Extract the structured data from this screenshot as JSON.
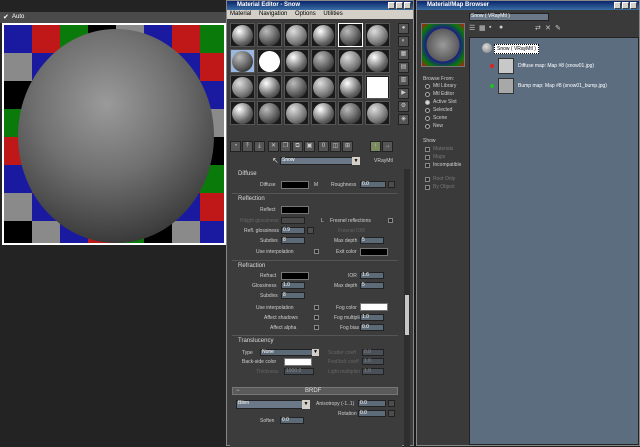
{
  "viewport": {
    "auto_label": "Auto"
  },
  "material_editor": {
    "title": "Material Editor - Snow",
    "menus": [
      "Material",
      "Navigation",
      "Options",
      "Utilities"
    ],
    "material_name": "Snow",
    "material_type": "VRayMtl",
    "diffuse": {
      "header": "Diffuse",
      "diffuse_label": "Diffuse",
      "m_label": "M",
      "roughness_label": "Roughness",
      "roughness_value": "0.0"
    },
    "reflection": {
      "header": "Reflection",
      "reflect_label": "Reflect",
      "hilight_label": "Hilight glossiness",
      "l_label": "L",
      "fresnel_label": "Fresnel reflections",
      "fresnel_ior_label": "Fresnel IOR",
      "refl_gloss_label": "Refl. glossiness",
      "refl_gloss_value": "0.9",
      "subdivs_label": "Subdivs",
      "subdivs_value": "8",
      "max_depth_label": "Max depth",
      "max_depth_value": "5",
      "use_interp_label": "Use interpolation",
      "exit_color_label": "Exit color"
    },
    "refraction": {
      "header": "Refraction",
      "refract_label": "Refract",
      "ior_label": "IOR",
      "ior_value": "1.6",
      "glossiness_label": "Glossiness",
      "glossiness_value": "1.0",
      "max_depth_label": "Max depth",
      "max_depth_value": "5",
      "subdivs_label": "Subdivs",
      "subdivs_value": "8",
      "use_interp_label": "Use interpolation",
      "fog_color_label": "Fog color",
      "affect_shadows_label": "Affect shadows",
      "fog_mult_label": "Fog multiplier",
      "fog_mult_value": "1.0",
      "affect_alpha_label": "Affect alpha",
      "fog_bias_label": "Fog bias",
      "fog_bias_value": "0.0"
    },
    "translucency": {
      "header": "Translucency",
      "type_label": "Type",
      "type_value": "None",
      "backside_label": "Back-side color",
      "thickness_label": "Thickness",
      "thickness_value": "1000.0",
      "scatter_coeff_label": "Scatter coeff",
      "scatter_coeff_value": "0.0",
      "fwd_bck_label": "Fwd/bck coeff",
      "fwd_bck_value": "1.0",
      "light_mult_label": "Light multiplier",
      "light_mult_value": "1.0"
    },
    "brdf": {
      "header": "BRDF",
      "type_value": "Blinn",
      "anisotropy_label": "Anisotropy (-1..1)",
      "anisotropy_value": "0.0",
      "rotation_label": "Rotation",
      "rotation_value": "0.0",
      "soften_label": "Soften",
      "soften_value": "0.0"
    }
  },
  "browser": {
    "title": "Material/Map Browser",
    "search_value": "Snow  ( VRayMtl )",
    "browse_from_label": "Browse From:",
    "browse_from": [
      "Mtl Library",
      "Mtl Editor",
      "Active Slot",
      "Selected",
      "Scene",
      "New"
    ],
    "browse_selected": "Active Slot",
    "show_label": "Show",
    "show_options": [
      "Materials",
      "Maps",
      "Incompatible"
    ],
    "root_options": [
      "Root Only",
      "By Object"
    ],
    "tree": [
      {
        "label": "Snow  ( VRayMtl )"
      },
      {
        "label": "Diffuse map: Map #8 (snow01.jpg)"
      },
      {
        "label": "Bump map: Map #8 (snow01_bump.jpg)"
      }
    ]
  },
  "colors": {
    "checker": [
      "#1a1aa0",
      "#c01818",
      "#0a7a0a",
      "#000000",
      "#8a8a8a"
    ]
  }
}
